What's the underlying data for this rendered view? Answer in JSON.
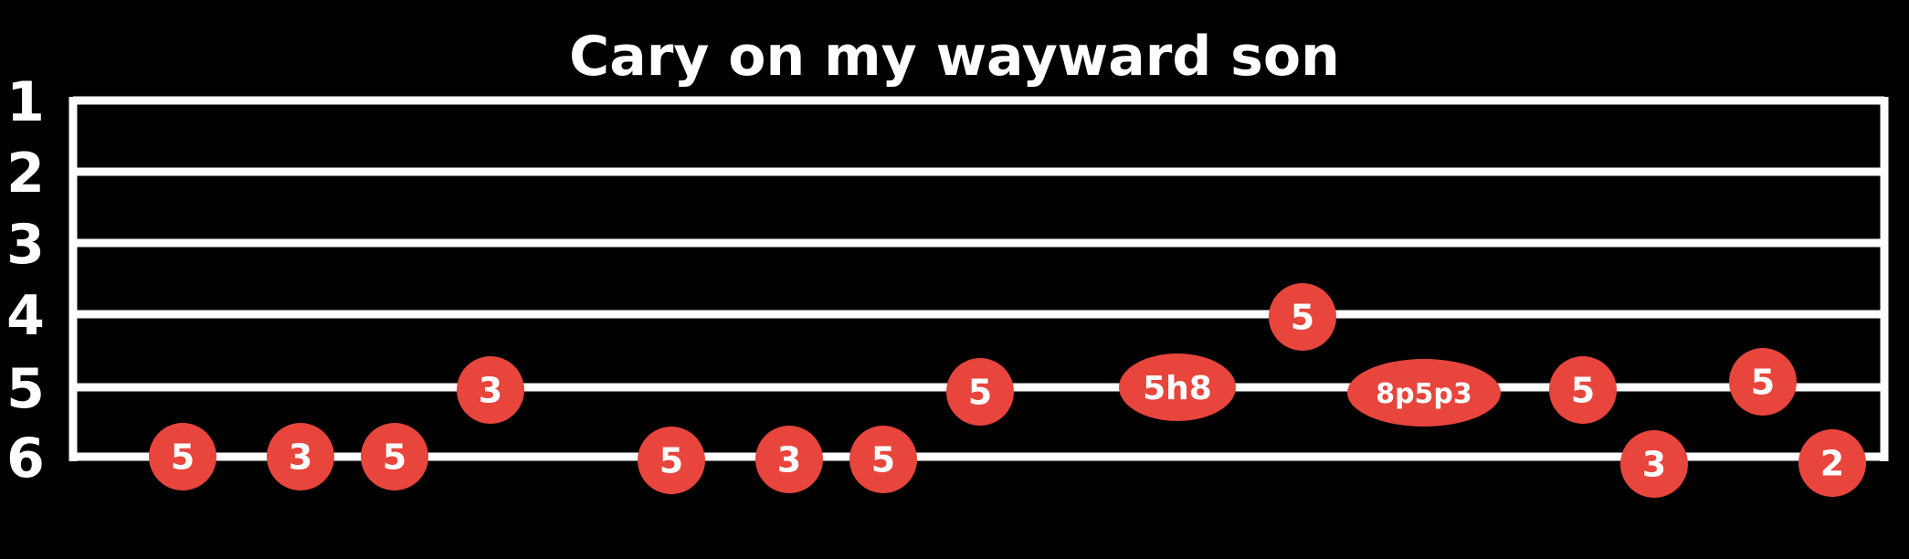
{
  "title": "Cary on my wayward son",
  "string_numbers": [
    "1",
    "2",
    "3",
    "4",
    "5",
    "6"
  ],
  "notes": [
    {
      "string": 6,
      "fret": "5"
    },
    {
      "string": 6,
      "fret": "3"
    },
    {
      "string": 6,
      "fret": "5"
    },
    {
      "string": 5,
      "fret": "3"
    },
    {
      "string": 6,
      "fret": "5"
    },
    {
      "string": 6,
      "fret": "3"
    },
    {
      "string": 6,
      "fret": "5"
    },
    {
      "string": 5,
      "fret": "5"
    },
    {
      "string": 5,
      "fret": "5h8"
    },
    {
      "string": 4,
      "fret": "5"
    },
    {
      "string": 5,
      "fret": "8p5p3"
    },
    {
      "string": 5,
      "fret": "5"
    },
    {
      "string": 6,
      "fret": "3"
    },
    {
      "string": 5,
      "fret": "5"
    },
    {
      "string": 6,
      "fret": "2"
    }
  ],
  "colors": {
    "background": "#000000",
    "lines": "#ffffff",
    "note_fill": "#e8453c",
    "text": "#ffffff"
  }
}
